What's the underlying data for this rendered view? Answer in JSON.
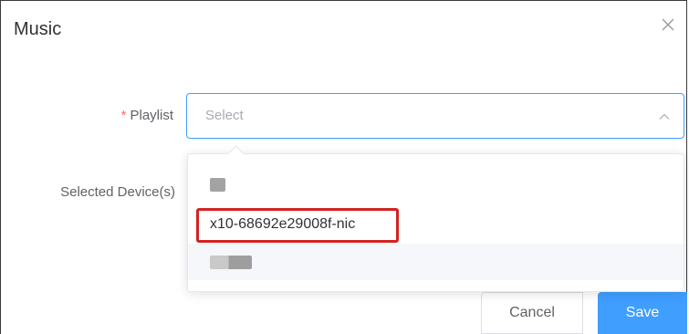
{
  "dialog": {
    "title": "Music",
    "close_icon": "close-icon"
  },
  "form": {
    "playlist": {
      "required_mark": "*",
      "label": "Playlist",
      "placeholder": "Select",
      "expanded": true
    },
    "devices": {
      "label": "Selected Device(s)"
    }
  },
  "dropdown": {
    "options": [
      {
        "label": "",
        "redacted": true
      },
      {
        "label": "x10-68692e29008f-nic",
        "highlighted": true
      },
      {
        "label": "",
        "redacted": true,
        "hovered": true
      }
    ]
  },
  "buttons": {
    "cancel": "Cancel",
    "save": "Save"
  },
  "colors": {
    "accent": "#409eff",
    "required": "#f56c6c",
    "highlight_border": "#d32222"
  }
}
